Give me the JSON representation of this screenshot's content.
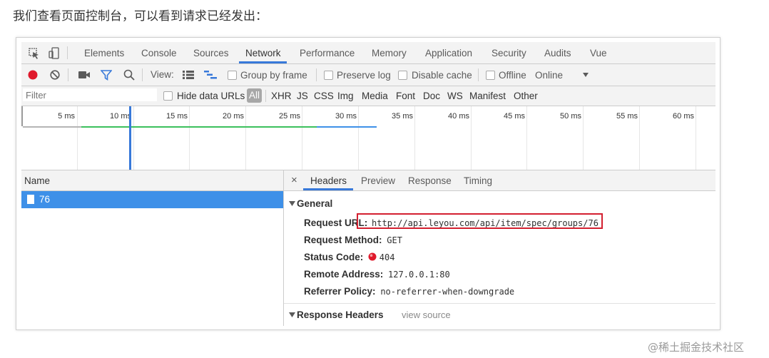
{
  "intro_text": "我们查看页面控制台，可以看到请求已经发出：",
  "tabs": [
    "Elements",
    "Console",
    "Sources",
    "Network",
    "Performance",
    "Memory",
    "Application",
    "Security",
    "Audits",
    "Vue"
  ],
  "active_tab": "Network",
  "toolbar": {
    "view_label": "View:",
    "group_by_frame": "Group by frame",
    "preserve_log": "Preserve log",
    "disable_cache": "Disable cache",
    "offline": "Offline",
    "online": "Online"
  },
  "filterbar": {
    "filter_placeholder": "Filter",
    "hide_data_urls": "Hide data URLs",
    "types": [
      "All",
      "XHR",
      "JS",
      "CSS",
      "Img",
      "Media",
      "Font",
      "Doc",
      "WS",
      "Manifest",
      "Other"
    ]
  },
  "timeline_ticks": [
    "5 ms",
    "10 ms",
    "15 ms",
    "20 ms",
    "25 ms",
    "30 ms",
    "35 ms",
    "40 ms",
    "45 ms",
    "50 ms",
    "55 ms",
    "60 ms"
  ],
  "name_header": "Name",
  "requests": [
    {
      "name": "76"
    }
  ],
  "detail_tabs": [
    "Headers",
    "Preview",
    "Response",
    "Timing"
  ],
  "active_detail_tab": "Headers",
  "close_symbol": "×",
  "general": {
    "title": "General",
    "request_url_key": "Request URL:",
    "request_url": "http://api.leyou.com/api/item/spec/groups/76",
    "request_method_key": "Request Method:",
    "request_method": "GET",
    "status_code_key": "Status Code:",
    "status_code": "404",
    "remote_address_key": "Remote Address:",
    "remote_address": "127.0.0.1:80",
    "referrer_policy_key": "Referrer Policy:",
    "referrer_policy": "no-referrer-when-downgrade"
  },
  "response_headers": {
    "title": "Response Headers",
    "view_source": "view source"
  },
  "watermark": "@稀土掘金技术社区",
  "colors": {
    "accent": "#3879d9",
    "selected_row": "#3e90e8",
    "record_red": "#e0192c",
    "highlight_box": "#d32030"
  }
}
